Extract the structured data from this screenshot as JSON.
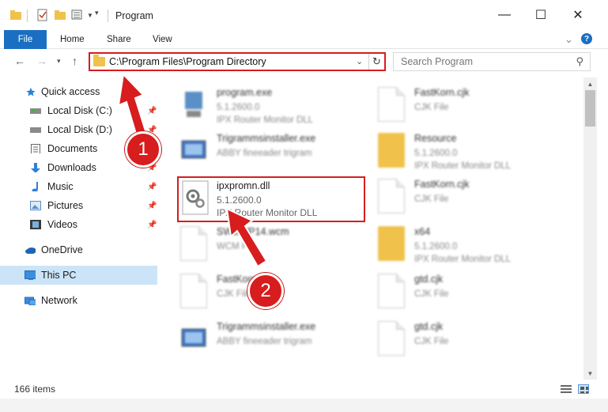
{
  "window": {
    "title": "Program",
    "minimize": "—",
    "maximize": "☐",
    "close": "✕"
  },
  "ribbon": {
    "tabs": [
      "File",
      "Home",
      "Share",
      "View"
    ],
    "expand": "⌄",
    "help": "?"
  },
  "address": {
    "path": "C:\\Program Files\\Program Directory",
    "search_placeholder": "Search Program"
  },
  "nav": {
    "items": [
      {
        "label": "Quick access",
        "icon": "star-icon",
        "pinned": false
      },
      {
        "label": "Local Disk (C:)",
        "icon": "drive-icon",
        "pinned": true
      },
      {
        "label": "Local Disk (D:)",
        "icon": "drive-icon",
        "pinned": true
      },
      {
        "label": "Documents",
        "icon": "documents-icon",
        "pinned": true
      },
      {
        "label": "Downloads",
        "icon": "download-icon",
        "pinned": true
      },
      {
        "label": "Music",
        "icon": "music-icon",
        "pinned": true
      },
      {
        "label": "Pictures",
        "icon": "pictures-icon",
        "pinned": true
      },
      {
        "label": "Videos",
        "icon": "videos-icon",
        "pinned": true
      },
      {
        "label": "OneDrive",
        "icon": "cloud-icon",
        "pinned": false
      },
      {
        "label": "This PC",
        "icon": "computer-icon",
        "pinned": false
      },
      {
        "label": "Network",
        "icon": "network-icon",
        "pinned": false
      }
    ]
  },
  "files": [
    {
      "name": "program.exe",
      "line1": "5.1.2600.0",
      "line2": "IPX Router Monitor DLL",
      "kind": "exe"
    },
    {
      "name": "FastKorn.cjk",
      "line1": "CJK File",
      "line2": "",
      "kind": "doc"
    },
    {
      "name": "Trigrammsinstaller.exe",
      "line1": "ABBY fineeader trigram",
      "line2": "",
      "kind": "exe2"
    },
    {
      "name": "Resource",
      "line1": "5.1.2600.0",
      "line2": "IPX Router Monitor DLL",
      "kind": "folder"
    },
    {
      "name": "ipxpromn.dll",
      "line1": "5.1.2600.0",
      "line2": "IPX Router Monitor DLL",
      "kind": "dll"
    },
    {
      "name": "FastKorn.cjk",
      "line1": "CJK File",
      "line2": "",
      "kind": "doc"
    },
    {
      "name": "SWBWP14.wcm",
      "line1": "WCM File",
      "line2": "",
      "kind": "doc"
    },
    {
      "name": "x64",
      "line1": "5.1.2600.0",
      "line2": "IPX Router Monitor DLL",
      "kind": "folder"
    },
    {
      "name": "FastKorn.cjk",
      "line1": "CJK File",
      "line2": "",
      "kind": "doc"
    },
    {
      "name": "gtd.cjk",
      "line1": "CJK File",
      "line2": "",
      "kind": "doc"
    },
    {
      "name": "Trigrammsinstaller.exe",
      "line1": "ABBY fineeader trigram",
      "line2": "",
      "kind": "exe2"
    },
    {
      "name": "gtd.cjk",
      "line1": "CJK File",
      "line2": "",
      "kind": "doc"
    }
  ],
  "status": {
    "count": "166 items"
  },
  "annotations": {
    "step1": "1",
    "step2": "2",
    "color": "#d71d1d"
  }
}
